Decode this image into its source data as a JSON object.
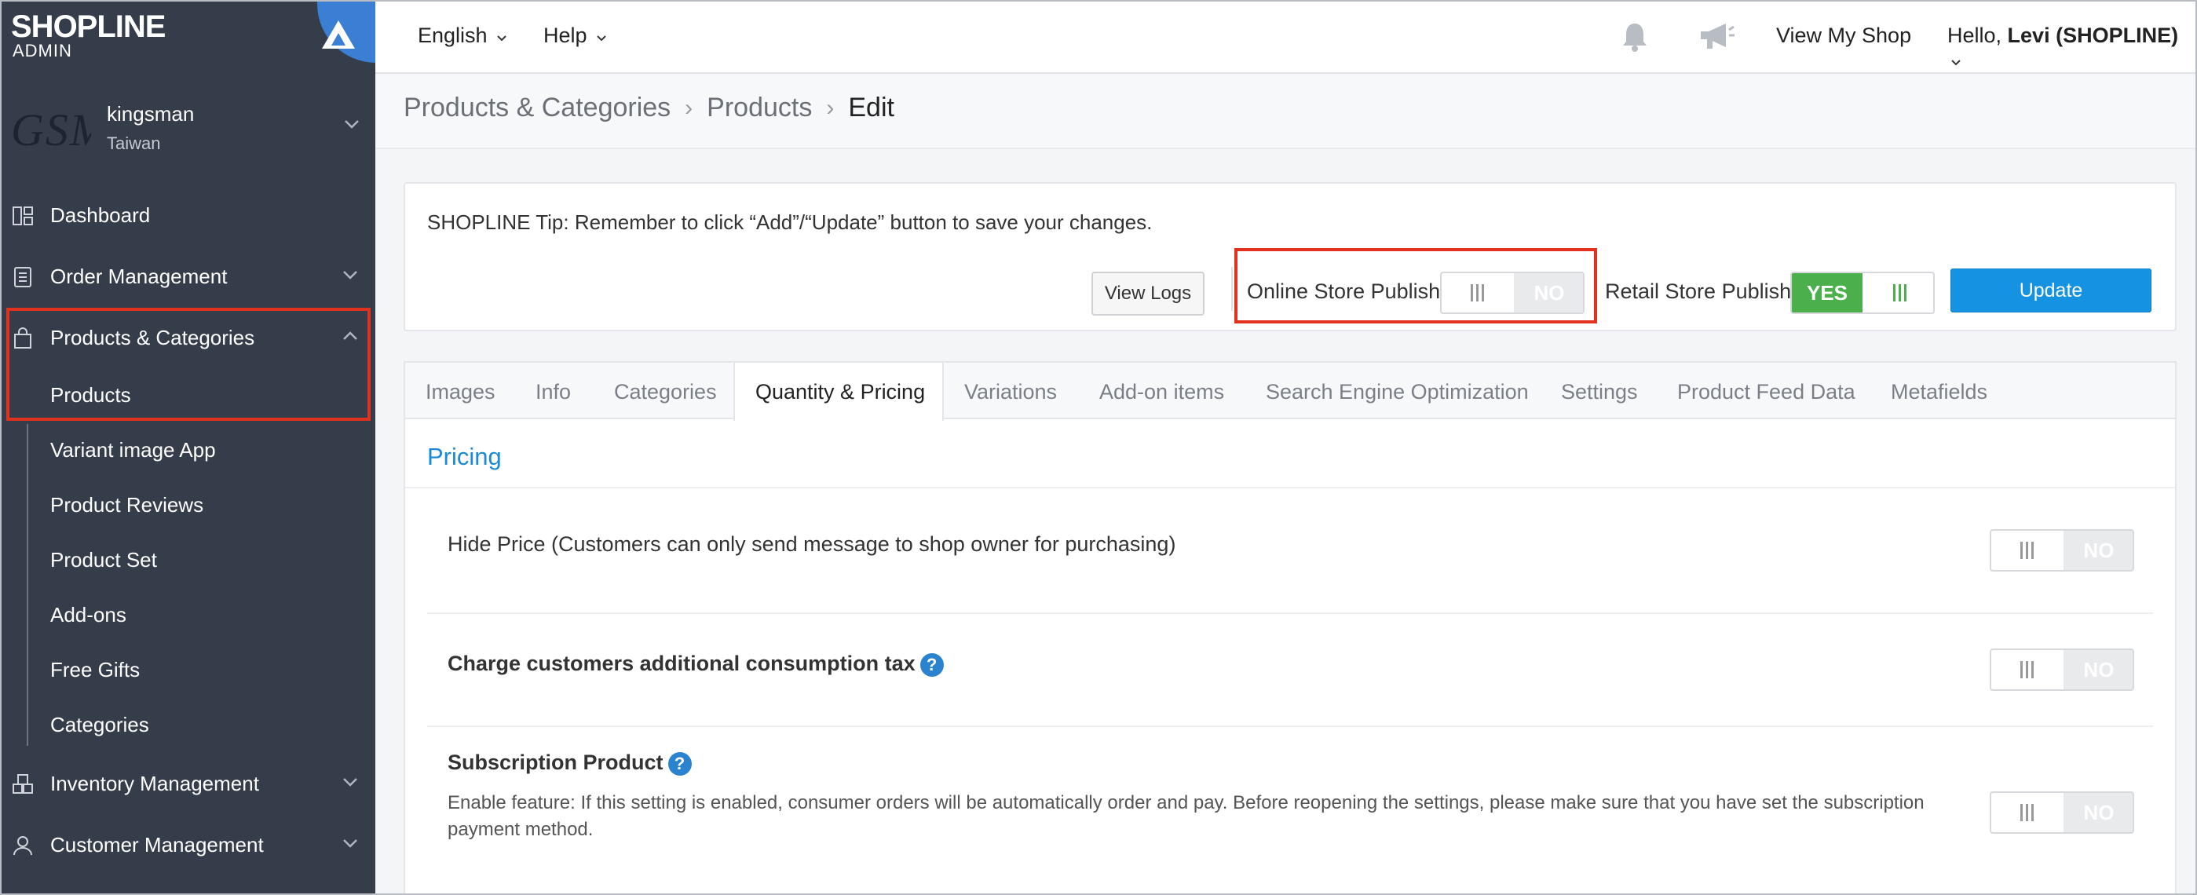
{
  "brand": {
    "logo": "SHOPLINE",
    "sub": "ADMIN"
  },
  "store": {
    "logo_text": "GSM",
    "name": "kingsman",
    "country": "Taiwan"
  },
  "sidebar": {
    "items": [
      {
        "label": "Dashboard",
        "icon": "dashboard-icon"
      },
      {
        "label": "Order Management",
        "icon": "order-icon"
      },
      {
        "label": "Products & Categories",
        "icon": "bag-icon"
      },
      {
        "label": "Inventory Management",
        "icon": "inventory-icon"
      },
      {
        "label": "Customer Management",
        "icon": "customer-icon"
      }
    ],
    "sub_items": [
      "Products",
      "Variant image App",
      "Product Reviews",
      "Product Set",
      "Add-ons",
      "Free Gifts",
      "Categories"
    ]
  },
  "topbar": {
    "language": "English",
    "help": "Help",
    "view_shop": "View My Shop",
    "hello_prefix": "Hello,",
    "hello_user": "Levi (SHOPLINE)"
  },
  "breadcrumb": {
    "items": [
      "Products & Categories",
      "Products"
    ],
    "current": "Edit"
  },
  "tip": {
    "text": "SHOPLINE Tip: Remember to click “Add”/“Update” button to save your changes.",
    "view_logs": "View Logs",
    "online_label": "Online Store Publish",
    "online_state": "NO",
    "retail_label": "Retail Store Publish",
    "retail_state": "YES",
    "update": "Update"
  },
  "tabs": [
    "Images",
    "Info",
    "Categories",
    "Quantity & Pricing",
    "Variations",
    "Add-on items",
    "Search Engine Optimization",
    "Settings",
    "Product Feed Data",
    "Metafields"
  ],
  "active_tab": "Quantity & Pricing",
  "pricing": {
    "title": "Pricing",
    "hide_price": {
      "label": "Hide Price (Customers can only send message to shop owner for purchasing)",
      "state": "NO"
    },
    "consumption_tax": {
      "label": "Charge customers additional consumption tax",
      "state": "NO"
    },
    "subscription": {
      "label": "Subscription Product",
      "desc": "Enable feature: If this setting is enabled, consumer orders will be automatically order and pay. Before reopening the settings, please make sure that you have set the subscription payment method.",
      "state": "NO"
    }
  },
  "colors": {
    "sidebar": "#353c4a",
    "accent": "#1593e2",
    "highlight": "#e0321e",
    "yes": "#4bb04b"
  }
}
